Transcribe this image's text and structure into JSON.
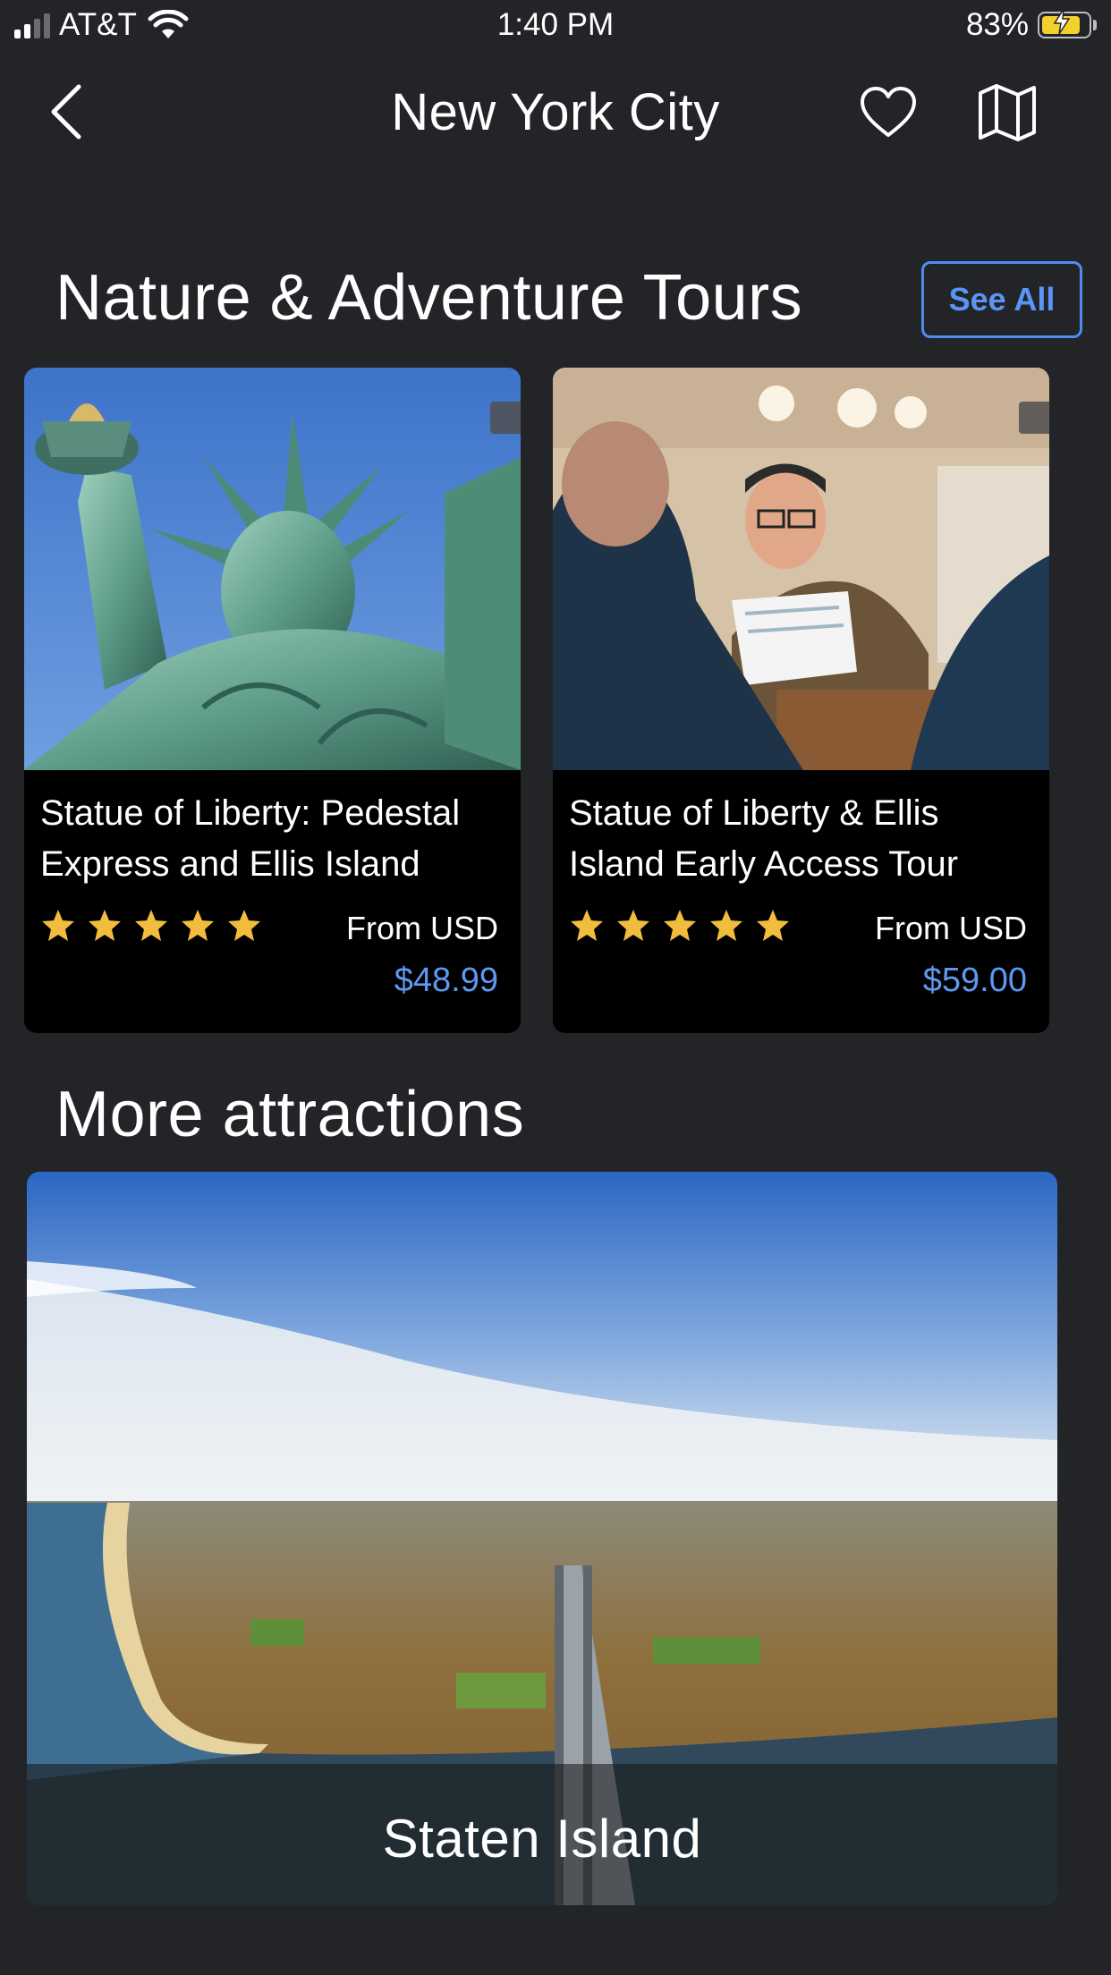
{
  "status_bar": {
    "carrier": "AT&T",
    "time": "1:40 PM",
    "battery": "83%"
  },
  "nav": {
    "title": "New York City",
    "back_icon": "chevron-left-icon",
    "favorite_icon": "heart-icon",
    "map_icon": "map-icon"
  },
  "section": {
    "title": "Nature & Adventure Tours",
    "see_all": "See All"
  },
  "tours": [
    {
      "title": "Statue of Liberty: Pedestal Express and Ellis Island",
      "rating": 5,
      "from_label": "From USD",
      "price": "$48.99"
    },
    {
      "title": "Statue of Liberty & Ellis Island Early Access Tour",
      "rating": 5,
      "from_label": "From USD",
      "price": "$59.00"
    }
  ],
  "more": {
    "title": "More attractions",
    "attractions": [
      {
        "name": "Staten Island"
      }
    ]
  },
  "colors": {
    "background": "#232427",
    "accent": "#5a95f5",
    "star": "#f2bd3c",
    "card": "#000000"
  }
}
